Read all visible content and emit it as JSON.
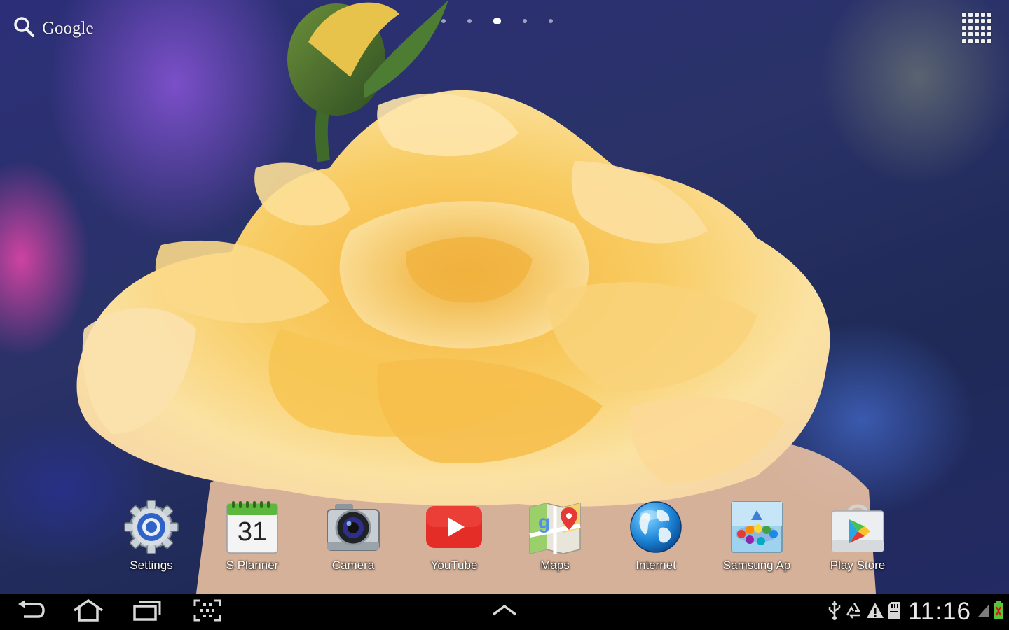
{
  "search": {
    "label": "Google"
  },
  "home_pages": {
    "count": 5,
    "active_index": 2
  },
  "apps": [
    {
      "label": "Settings",
      "icon": "settings-gear-icon"
    },
    {
      "label": "S Planner",
      "icon": "calendar-icon",
      "date": "31"
    },
    {
      "label": "Camera",
      "icon": "camera-icon"
    },
    {
      "label": "YouTube",
      "icon": "youtube-play-icon"
    },
    {
      "label": "Maps",
      "icon": "maps-icon"
    },
    {
      "label": "Internet",
      "icon": "globe-icon"
    },
    {
      "label": "Samsung Ap",
      "icon": "samsung-apps-icon"
    },
    {
      "label": "Play Store",
      "icon": "play-store-bag-icon"
    }
  ],
  "status": {
    "time": "11:16",
    "icons": [
      "usb-icon",
      "recycle-sync-icon",
      "warning-icon",
      "sd-card-icon",
      "signal-icon",
      "battery-charging-icon"
    ]
  },
  "colors": {
    "nav_bar": "#000000",
    "youtube_red": "#e52d27",
    "petal_yellow": "#f7c65a"
  }
}
